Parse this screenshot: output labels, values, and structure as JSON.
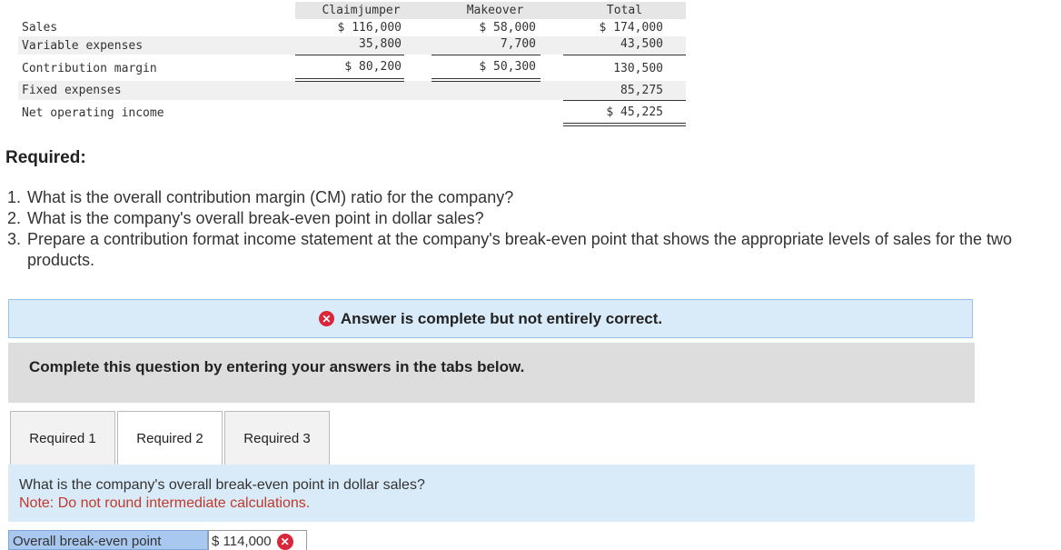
{
  "statement": {
    "headers": [
      "Claimjumper",
      "Makeover",
      "Total"
    ],
    "rows": [
      {
        "label": "Sales",
        "claimjumper": "$ 116,000",
        "makeover": "$ 58,000",
        "total": "$ 174,000"
      },
      {
        "label": "Variable expenses",
        "claimjumper": "35,800",
        "makeover": "7,700",
        "total": "43,500"
      },
      {
        "label": "Contribution margin",
        "claimjumper": "$ 80,200",
        "makeover": "$ 50,300",
        "total": "130,500"
      },
      {
        "label": "Fixed expenses",
        "claimjumper": "",
        "makeover": "",
        "total": "85,275"
      },
      {
        "label": "Net operating income",
        "claimjumper": "",
        "makeover": "",
        "total": "$ 45,225"
      }
    ]
  },
  "required": {
    "heading": "Required:",
    "items": [
      {
        "num": "1.",
        "text": "What is the overall contribution margin (CM) ratio for the company?"
      },
      {
        "num": "2.",
        "text": "What is the company's overall break-even point in dollar sales?"
      },
      {
        "num": "3.",
        "text": "Prepare a contribution format income statement at the company's break-even point that shows the appropriate levels of sales for the two products."
      }
    ]
  },
  "feedback": {
    "status": "Answer is complete but not entirely correct.",
    "instruction": "Complete this question by entering your answers in the tabs below."
  },
  "tabs": [
    {
      "label": "Required 1"
    },
    {
      "label": "Required 2"
    },
    {
      "label": "Required 3"
    }
  ],
  "active_tab": "Required 2",
  "panel": {
    "question": "What is the company's overall break-even point in dollar sales?",
    "note": "Note: Do not round intermediate calculations."
  },
  "answer": {
    "label": "Overall break-even point",
    "value": "$ 114,000"
  },
  "colors": {
    "error": "#d9263b",
    "note": "#c0392b",
    "banner": "#d9ebf9",
    "header_bg": "#e6e6e6"
  },
  "icons": {
    "incorrect": "x-circle-icon"
  }
}
